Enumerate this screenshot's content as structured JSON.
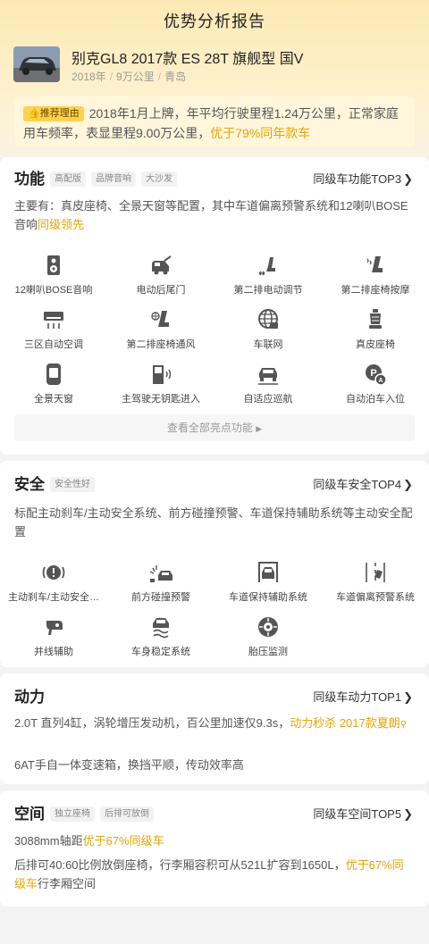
{
  "page_title": "优势分析报告",
  "car": {
    "name": "别克GL8 2017款 ES 28T 旗舰型 国V",
    "year": "2018年",
    "mileage": "9万公里",
    "city": "青岛"
  },
  "recommend": {
    "tag": "推荐理由",
    "text": "2018年1月上牌，年平均行驶里程1.24万公里，正常家庭用车频率，表显里程9.00万公里，",
    "highlight": "优于79%同年款车"
  },
  "function": {
    "title": "功能",
    "chips": [
      "高配版",
      "品牌音响",
      "大沙发"
    ],
    "link": "同级车功能TOP3",
    "desc": "主要有：真皮座椅、全景天窗等配置，其中车道偏离预警系统和12喇叭BOSE音响",
    "desc_hl": "同级领先",
    "items": [
      {
        "label": "12喇叭BOSE音响",
        "icon": "speaker-icon"
      },
      {
        "label": "电动后尾门",
        "icon": "power-tailgate-icon"
      },
      {
        "label": "第二排电动调节",
        "icon": "seat-adjust-icon"
      },
      {
        "label": "第二排座椅按摩",
        "icon": "seat-massage-icon"
      },
      {
        "label": "三区自动空调",
        "icon": "air-conditioner-icon"
      },
      {
        "label": "第二排座椅通风",
        "icon": "seat-ventilation-icon"
      },
      {
        "label": "车联网",
        "icon": "globe-icon"
      },
      {
        "label": "真皮座椅",
        "icon": "leather-seat-icon"
      },
      {
        "label": "全景天窗",
        "icon": "sunroof-icon"
      },
      {
        "label": "主驾驶无钥匙进入",
        "icon": "keyless-entry-icon"
      },
      {
        "label": "自适应巡航",
        "icon": "adaptive-cruise-icon"
      },
      {
        "label": "自动泊车入位",
        "icon": "auto-parking-icon"
      }
    ],
    "more": "查看全部亮点功能"
  },
  "safety": {
    "title": "安全",
    "chips": [
      "安全性好"
    ],
    "link": "同级车安全TOP4",
    "desc": "标配主动刹车/主动安全系统、前方碰撞预警、车道保持辅助系统等主动安全配置",
    "items": [
      {
        "label": "主动刹车/主动安全…",
        "icon": "brake-warning-icon"
      },
      {
        "label": "前方碰撞预警",
        "icon": "collision-warning-icon"
      },
      {
        "label": "车道保持辅助系统",
        "icon": "lane-keep-icon"
      },
      {
        "label": "车道偏离预警系统",
        "icon": "lane-departure-icon"
      },
      {
        "label": "并线辅助",
        "icon": "mirror-assist-icon"
      },
      {
        "label": "车身稳定系统",
        "icon": "stability-icon"
      },
      {
        "label": "胎压监测",
        "icon": "tire-pressure-icon"
      }
    ]
  },
  "power": {
    "title": "动力",
    "link": "同级车动力TOP1",
    "desc1": "2.0T 直列4缸，涡轮增压发动机，百公里加速仅9.3s，",
    "desc1_hl": "动力秒杀 2017款夏朗",
    "desc2": "6AT手自一体变速箱，换挡平顺，传动效率高"
  },
  "space": {
    "title": "空间",
    "chips": [
      "独立座椅",
      "后排可放倒"
    ],
    "link": "同级车空间TOP5",
    "desc1": "3088mm轴距",
    "desc1_hl": "优于67%同级车",
    "desc2": "后排可40:60比例放倒座椅，行李厢容积可从521L扩容到1650L，",
    "desc2_hl": "优于67%同级车",
    "desc2_tail": "行李厢空间"
  },
  "colors": {
    "accent": "#e6a400",
    "tag_bg": "#ffd24d",
    "icon": "#555555"
  }
}
